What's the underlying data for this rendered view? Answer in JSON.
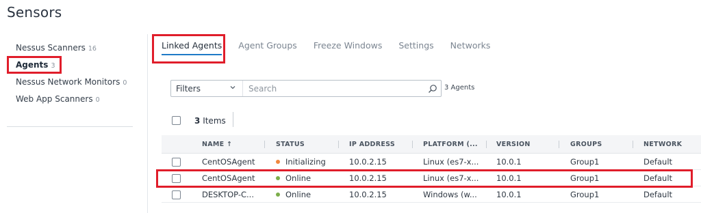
{
  "page": {
    "title": "Sensors"
  },
  "sidebar": {
    "items": [
      {
        "label": "Nessus Scanners",
        "count": "16"
      },
      {
        "label": "Agents",
        "count": "3"
      },
      {
        "label": "Nessus Network Monitors",
        "count": "0"
      },
      {
        "label": "Web App Scanners",
        "count": "0"
      }
    ]
  },
  "tabs": [
    {
      "label": "Linked Agents"
    },
    {
      "label": "Agent Groups"
    },
    {
      "label": "Freeze Windows"
    },
    {
      "label": "Settings"
    },
    {
      "label": "Networks"
    }
  ],
  "filter": {
    "select_label": "Filters",
    "search_placeholder": "Search",
    "agent_count": "3 Agents"
  },
  "toolbar": {
    "items_count": "3",
    "items_label": "Items"
  },
  "table": {
    "columns": [
      "NAME ↑",
      "STATUS",
      "IP ADDRESS",
      "PLATFORM (...",
      "VERSION",
      "GROUPS",
      "NETWORK"
    ],
    "rows": [
      {
        "name": "CentOSAgent",
        "status": "Initializing",
        "ip": "10.0.2.15",
        "platform": "Linux (es7-x...",
        "version": "10.0.1",
        "groups": "Group1",
        "network": "Default"
      },
      {
        "name": "CentOSAgent",
        "status": "Online",
        "ip": "10.0.2.15",
        "platform": "Linux (es7-x...",
        "version": "10.0.1",
        "groups": "Group1",
        "network": "Default"
      },
      {
        "name": "DESKTOP-C...",
        "status": "Online",
        "ip": "10.0.2.15",
        "platform": "Windows (w...",
        "version": "10.0.1",
        "groups": "Group1",
        "network": "Default"
      }
    ]
  },
  "colors": {
    "highlight": "#e01d2a",
    "status_initializing": "#f0883e",
    "status_online": "#7cae4a",
    "tab_underline": "#1e7ac7"
  },
  "icons": {
    "search": "search-icon",
    "chevron": "chevron-down-icon",
    "sort": "arrow-up-icon"
  }
}
